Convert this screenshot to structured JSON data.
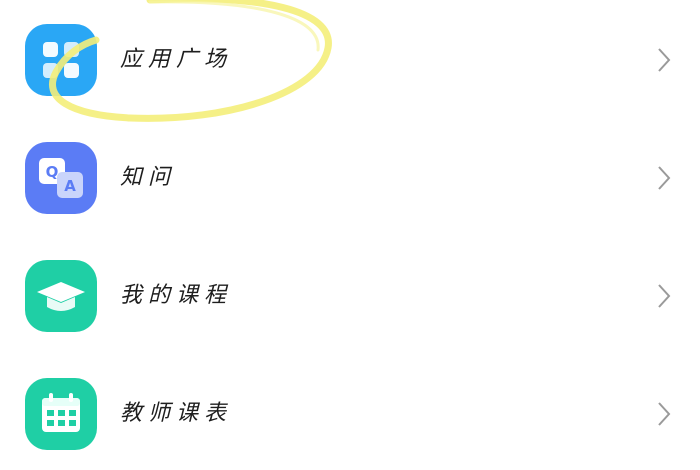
{
  "menu": {
    "items": [
      {
        "label": "应用广场",
        "icon": "app-grid-icon",
        "color": "#2aa7f5"
      },
      {
        "label": "知问",
        "icon": "qa-icon",
        "color": "#5b7cf5"
      },
      {
        "label": "我的课程",
        "icon": "graduation-cap-icon",
        "color": "#1fcfa5"
      },
      {
        "label": "教师课表",
        "icon": "calendar-icon",
        "color": "#1fcfa5"
      }
    ]
  },
  "icon_glyphs": {
    "qa_q": "Q",
    "qa_a": "A"
  },
  "colors": {
    "highlight_stroke": "#f4ee7a",
    "chevron": "#9a9a9a"
  }
}
